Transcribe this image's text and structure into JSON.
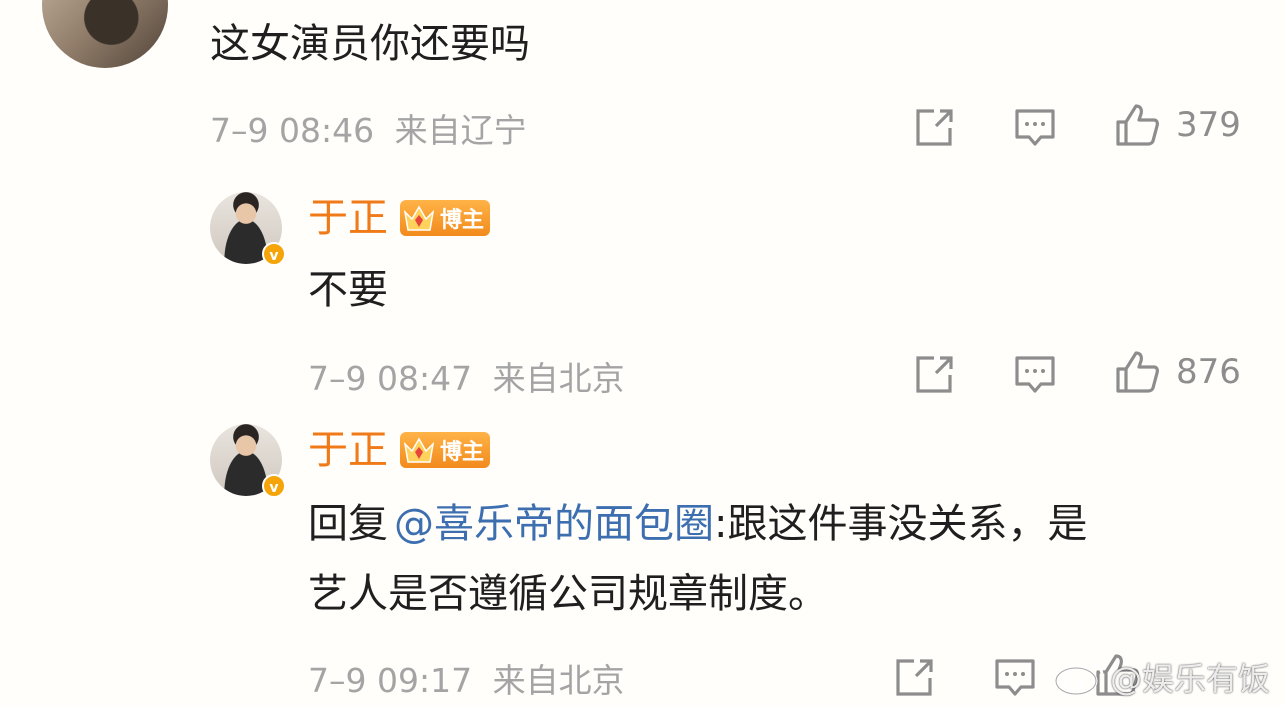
{
  "comment_top": {
    "text": "这女演员你还要吗",
    "time": "7–9 08:46",
    "location": "来自辽宁",
    "likes": "379"
  },
  "replies": [
    {
      "name": "于正",
      "badge": "博主",
      "text": "不要",
      "time": "7–9 08:47",
      "location": "来自北京",
      "likes": "876"
    },
    {
      "name": "于正",
      "badge": "博主",
      "reply_prefix": "回复",
      "mention": "@喜乐帝的面包圈",
      "line1_rest": ":跟这件事没关系，是",
      "line2": "艺人是否遵循公司规章制度。",
      "time": "7–9 09:17",
      "location": "来自北京"
    }
  ],
  "watermark": "@娱乐有饭",
  "icons": {
    "share": "share-icon",
    "comment": "comment-icon",
    "like": "like-icon",
    "verified": "verified-badge-icon",
    "crown": "crown-icon",
    "weibo": "weibo-logo-icon"
  },
  "colors": {
    "name": "#f07a18",
    "mention": "#3d6fb0",
    "meta": "#a4a4a4",
    "badge": "#f28a1c"
  }
}
